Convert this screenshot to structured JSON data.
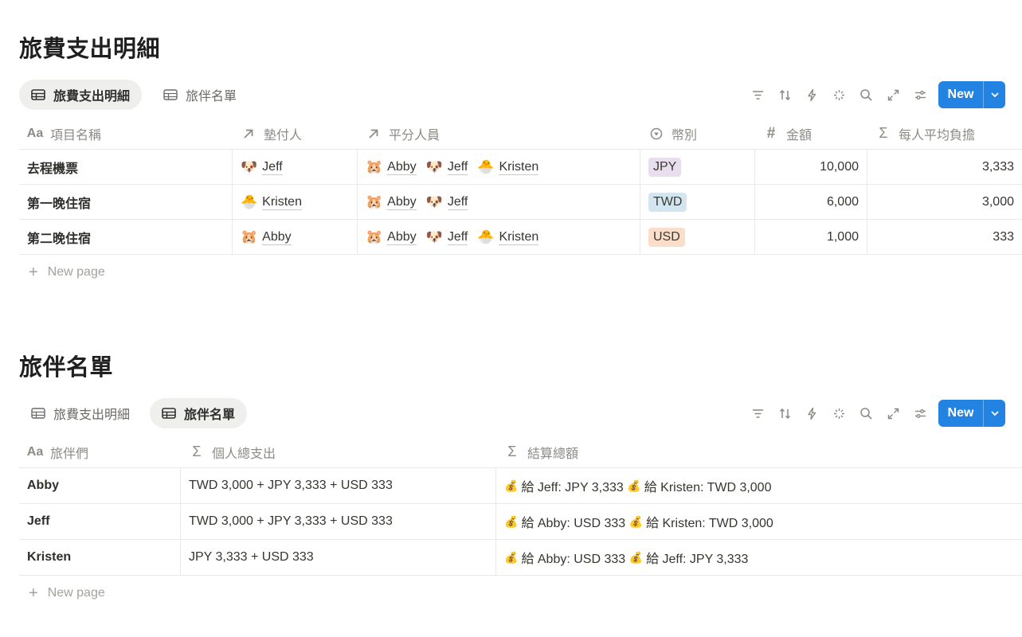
{
  "expenses": {
    "title": "旅費支出明細",
    "tabs": [
      {
        "label": "旅費支出明細",
        "active": true
      },
      {
        "label": "旅伴名單",
        "active": false
      }
    ],
    "new_label": "New",
    "columns": [
      {
        "label": "項目名稱",
        "icon": "Aa"
      },
      {
        "label": "墊付人",
        "icon": "relation-arrow-icon"
      },
      {
        "label": "平分人員",
        "icon": "relation-arrow-icon"
      },
      {
        "label": "幣別",
        "icon": "select-icon"
      },
      {
        "label": "金額",
        "icon": "#"
      },
      {
        "label": "每人平均負擔",
        "icon": "Σ"
      }
    ],
    "rows": [
      {
        "name": "去程機票",
        "payer": {
          "emoji": "🐶",
          "name": "Jeff"
        },
        "split": [
          {
            "emoji": "🐹",
            "name": "Abby"
          },
          {
            "emoji": "🐶",
            "name": "Jeff"
          },
          {
            "emoji": "🐣",
            "name": "Kristen"
          }
        ],
        "currency": "JPY",
        "currency_color": "#e8deee",
        "amount": "10,000",
        "avg": "3,333"
      },
      {
        "name": "第一晚住宿",
        "payer": {
          "emoji": "🐣",
          "name": "Kristen"
        },
        "split": [
          {
            "emoji": "🐹",
            "name": "Abby"
          },
          {
            "emoji": "🐶",
            "name": "Jeff"
          }
        ],
        "currency": "TWD",
        "currency_color": "#d3e5ef",
        "amount": "6,000",
        "avg": "3,000"
      },
      {
        "name": "第二晚住宿",
        "payer": {
          "emoji": "🐹",
          "name": "Abby"
        },
        "split": [
          {
            "emoji": "🐹",
            "name": "Abby"
          },
          {
            "emoji": "🐶",
            "name": "Jeff"
          },
          {
            "emoji": "🐣",
            "name": "Kristen"
          }
        ],
        "currency": "USD",
        "currency_color": "#fadec9",
        "amount": "1,000",
        "avg": "333"
      }
    ],
    "new_page_label": "New page"
  },
  "companions": {
    "title": "旅伴名單",
    "tabs": [
      {
        "label": "旅費支出明細",
        "active": false
      },
      {
        "label": "旅伴名單",
        "active": true
      }
    ],
    "new_label": "New",
    "columns": [
      {
        "label": "旅伴們",
        "icon": "Aa"
      },
      {
        "label": "個人總支出",
        "icon": "Σ"
      },
      {
        "label": "結算總額",
        "icon": "Σ"
      }
    ],
    "rows": [
      {
        "name": "Abby",
        "total": "TWD 3,000 + JPY 3,333 + USD 333",
        "settle": [
          {
            "emoji": "💰",
            "text": "給 Jeff: JPY 3,333"
          },
          {
            "emoji": "💰",
            "text": "給 Kristen: TWD 3,000"
          }
        ]
      },
      {
        "name": "Jeff",
        "total": "TWD 3,000 + JPY 3,333 + USD 333",
        "settle": [
          {
            "emoji": "💰",
            "text": "給 Abby: USD 333"
          },
          {
            "emoji": "💰",
            "text": "給 Kristen: TWD 3,000"
          }
        ]
      },
      {
        "name": "Kristen",
        "total": "JPY 3,333 + USD 333",
        "settle": [
          {
            "emoji": "💰",
            "text": "給 Abby: USD 333"
          },
          {
            "emoji": "💰",
            "text": "給 Jeff: JPY 3,333"
          }
        ]
      }
    ],
    "new_page_label": "New page"
  },
  "colors": {
    "accent": "#2383e2",
    "border": "#e9e9e7",
    "muted_text": "#8c8b86"
  }
}
